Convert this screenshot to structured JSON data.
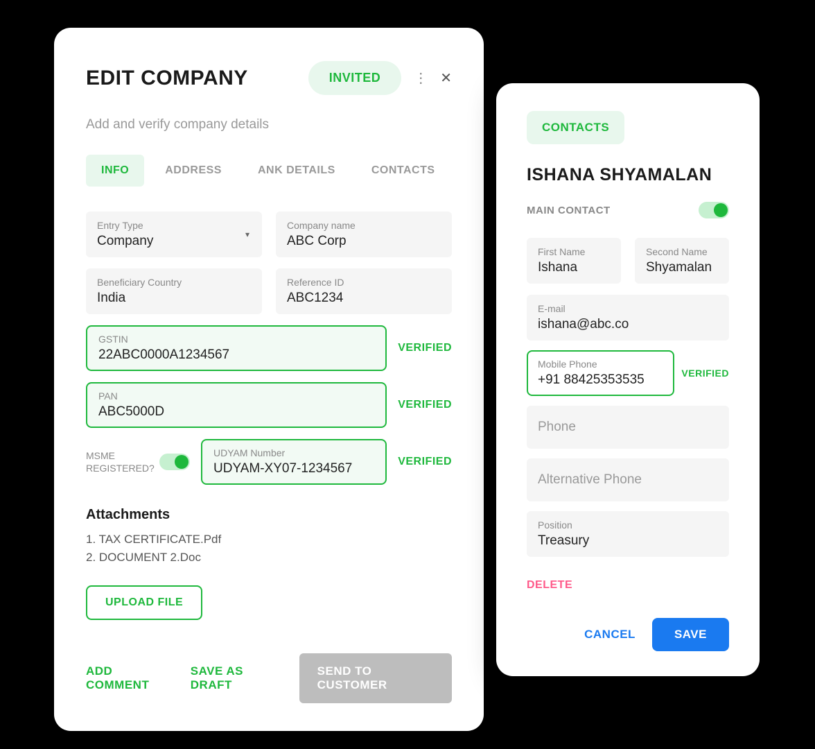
{
  "left": {
    "title": "EDIT COMPANY",
    "status_badge": "INVITED",
    "subtitle": "Add and verify company details",
    "tabs": [
      "INFO",
      "ADDRESS",
      "ANK DETAILS",
      "CONTACTS"
    ],
    "entry_type": {
      "label": "Entry Type",
      "value": "Company"
    },
    "company_name": {
      "label": "Company name",
      "value": "ABC Corp"
    },
    "beneficiary_country": {
      "label": "Beneficiary Country",
      "value": "India"
    },
    "reference_id": {
      "label": "Reference ID",
      "value": "ABC1234"
    },
    "gstin": {
      "label": "GSTIN",
      "value": "22ABC0000A1234567",
      "status": "VERIFIED"
    },
    "pan": {
      "label": "PAN",
      "value": "ABC5000D",
      "status": "VERIFIED"
    },
    "msme_label": "MSME REGISTERED?",
    "udyam": {
      "label": "UDYAM Number",
      "value": "UDYAM-XY07-1234567",
      "status": "VERIFIED"
    },
    "attachments_title": "Attachments",
    "attachments": [
      "1. TAX CERTIFICATE.Pdf",
      "2. DOCUMENT 2.Doc"
    ],
    "upload_label": "UPLOAD FILE",
    "actions": {
      "add_comment": "ADD COMMENT",
      "save_draft": "SAVE AS DRAFT",
      "send": "SEND TO CUSTOMER"
    }
  },
  "right": {
    "badge": "CONTACTS",
    "name": "ISHANA SHYAMALAN",
    "main_contact_label": "MAIN CONTACT",
    "first_name": {
      "label": "First Name",
      "value": "Ishana"
    },
    "second_name": {
      "label": "Second Name",
      "value": "Shyamalan"
    },
    "email": {
      "label": "E-mail",
      "value": "ishana@abc.co"
    },
    "mobile": {
      "label": "Mobile Phone",
      "value": "+91 88425353535",
      "status": "VERIFIED"
    },
    "phone_placeholder": "Phone",
    "alt_phone_placeholder": "Alternative Phone",
    "position": {
      "label": "Position",
      "value": "Treasury"
    },
    "delete": "DELETE",
    "cancel": "CANCEL",
    "save": "SAVE"
  }
}
